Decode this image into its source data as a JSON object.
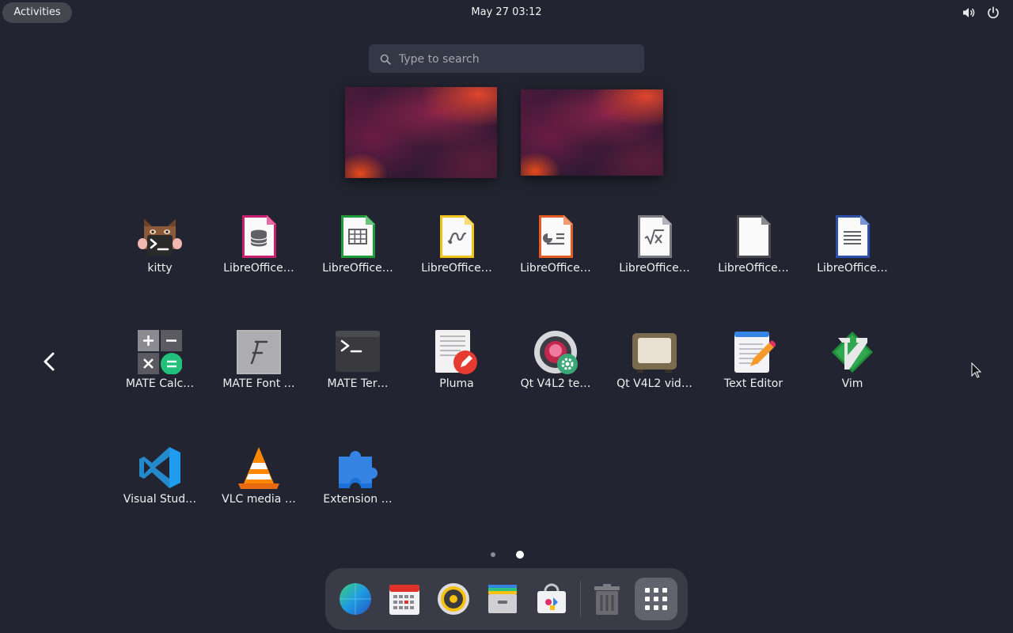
{
  "topbar": {
    "activities_label": "Activities",
    "clock": "May 27  03:12",
    "icons": [
      "volume-icon",
      "power-icon"
    ]
  },
  "search": {
    "placeholder": "Type to search",
    "value": ""
  },
  "workspaces": [
    "workspace-1",
    "workspace-2"
  ],
  "apps": [
    {
      "label": "kitty",
      "icon": "kitty-icon"
    },
    {
      "label": "LibreOffice…",
      "icon": "libreoffice-base-icon"
    },
    {
      "label": "LibreOffice…",
      "icon": "libreoffice-calc-icon"
    },
    {
      "label": "LibreOffice…",
      "icon": "libreoffice-draw-icon"
    },
    {
      "label": "LibreOffice…",
      "icon": "libreoffice-impress-icon"
    },
    {
      "label": "LibreOffice…",
      "icon": "libreoffice-math-icon"
    },
    {
      "label": "LibreOffice…",
      "icon": "libreoffice-icon"
    },
    {
      "label": "LibreOffice…",
      "icon": "libreoffice-writer-icon"
    },
    {
      "label": "MATE Calc…",
      "icon": "mate-calculator-icon"
    },
    {
      "label": "MATE Font …",
      "icon": "mate-font-viewer-icon"
    },
    {
      "label": "MATE Ter…",
      "icon": "mate-terminal-icon"
    },
    {
      "label": "Pluma",
      "icon": "pluma-icon"
    },
    {
      "label": "Qt V4L2 te…",
      "icon": "qt-v4l2-test-icon"
    },
    {
      "label": "Qt V4L2 vid…",
      "icon": "qt-v4l2-video-icon"
    },
    {
      "label": "Text Editor",
      "icon": "text-editor-icon"
    },
    {
      "label": "Vim",
      "icon": "vim-icon"
    },
    {
      "label": "Visual Stud…",
      "icon": "vscode-icon"
    },
    {
      "label": "VLC media …",
      "icon": "vlc-icon"
    },
    {
      "label": "Extension …",
      "icon": "extension-icon"
    }
  ],
  "pagination": {
    "pages": 2,
    "current": 2
  },
  "dock": {
    "items": [
      "browser-icon",
      "calendar-icon",
      "rhythmbox-icon",
      "files-icon",
      "software-icon",
      "trash-icon",
      "show-apps-icon"
    ]
  },
  "colors": {
    "background": "#222431",
    "dock": "#393b46",
    "search": "#343746"
  }
}
